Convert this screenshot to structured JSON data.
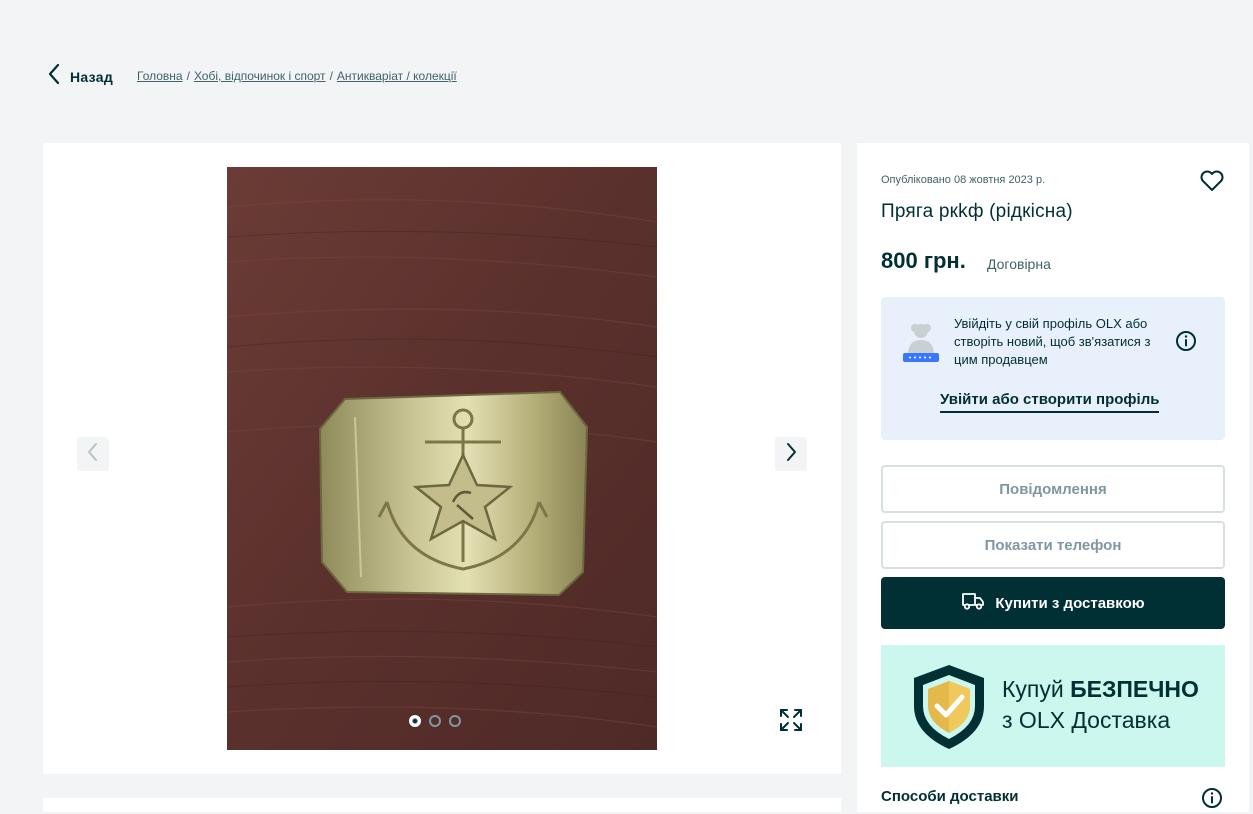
{
  "nav": {
    "back_label": "Назад",
    "breadcrumbs": [
      "Головна",
      "Хобі, відпочинок і спорт",
      "Антикваріат / колекції"
    ],
    "separator": "/"
  },
  "gallery": {
    "photo_count": 3,
    "active_index": 0
  },
  "listing": {
    "published": "Опубліковано 08 жовтня 2023 р.",
    "title": "Пряга ркkф (рідкісна)",
    "price": "800 грн.",
    "negotiable": "Договірна"
  },
  "login": {
    "text": "Увійдіть у свій профіль OLX або створіть новий, щоб зв'язатися з цим продавцем",
    "link": "Увійти або створити профіль"
  },
  "actions": {
    "message": "Повідомлення",
    "phone": "Показати телефон",
    "buy": "Купити з доставкою"
  },
  "promo": {
    "line1_prefix": "Купуй ",
    "line1_bold": "БЕЗПЕЧНО",
    "line2": "з OLX Доставка"
  },
  "delivery": {
    "label": "Способи доставки"
  },
  "colors": {
    "primary": "#002f34",
    "background": "#f2f4f5",
    "login_bg": "#e8f0fc",
    "promo_bg": "#cbf7ee",
    "shield_gold": "#e4b84a"
  }
}
